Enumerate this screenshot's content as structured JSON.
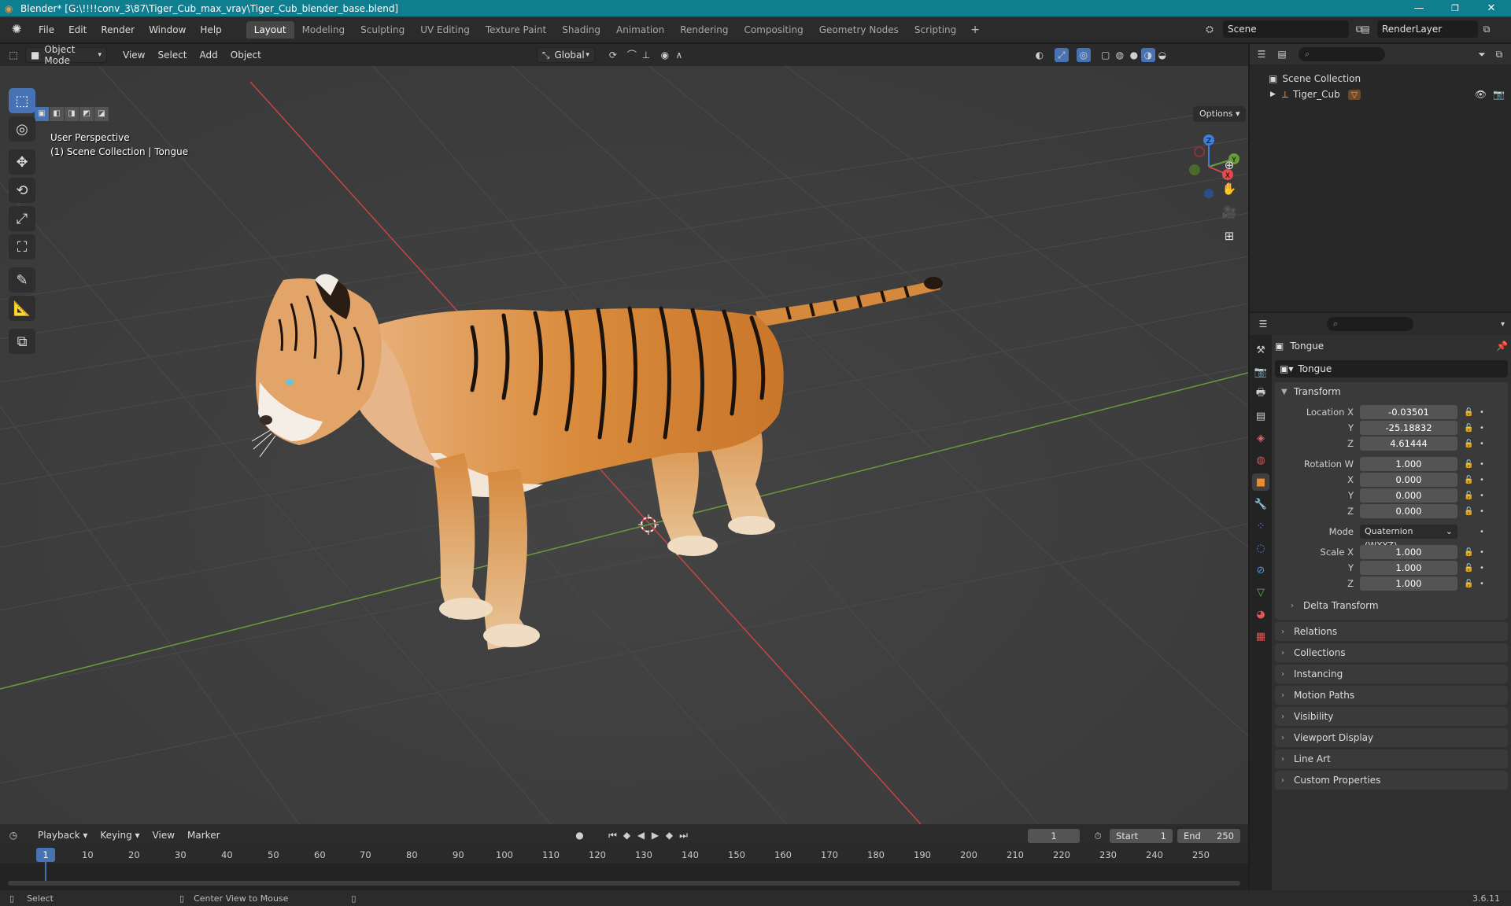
{
  "window": {
    "title": "Blender* [G:\\!!!!conv_3\\87\\Tiger_Cub_max_vray\\Tiger_Cub_blender_base.blend]",
    "minimize": "—",
    "maximize": "❐",
    "close": "✕"
  },
  "menus": [
    "File",
    "Edit",
    "Render",
    "Window",
    "Help"
  ],
  "workspaces": [
    "Layout",
    "Modeling",
    "Sculpting",
    "UV Editing",
    "Texture Paint",
    "Shading",
    "Animation",
    "Rendering",
    "Compositing",
    "Geometry Nodes",
    "Scripting"
  ],
  "active_workspace": "Layout",
  "add_workspace": "+",
  "scene_name": "Scene",
  "render_layer": "RenderLayer",
  "viewport": {
    "mode": "Object Mode",
    "menus": [
      "View",
      "Select",
      "Add",
      "Object"
    ],
    "orientation": "Global",
    "options_label": "Options",
    "info_line1": "User Perspective",
    "info_line2": "(1) Scene Collection | Tongue",
    "gizmo": {
      "z": "Z",
      "y": "Y",
      "x": "X"
    }
  },
  "outliner": {
    "search_placeholder": "",
    "root": "Scene Collection",
    "items": [
      {
        "name": "Tiger_Cub"
      }
    ]
  },
  "properties": {
    "object_name": "Tongue",
    "data_name": "Tongue",
    "transform_title": "Transform",
    "location": {
      "label": "Location X",
      "x": "-0.03501",
      "y": "-25.18832",
      "z": "4.61444"
    },
    "rotation": {
      "label": "Rotation W",
      "w": "1.000",
      "x": "0.000",
      "y": "0.000",
      "z": "0.000"
    },
    "mode_label": "Mode",
    "mode_value": "Quaternion (WXYZ)",
    "scale": {
      "label": "Scale X",
      "x": "1.000",
      "y": "1.000",
      "z": "1.000"
    },
    "axis_labels": {
      "y": "Y",
      "z": "Z",
      "x": "X"
    },
    "delta_transform": "Delta Transform",
    "panels": [
      "Relations",
      "Collections",
      "Instancing",
      "Motion Paths",
      "Visibility",
      "Viewport Display",
      "Line Art",
      "Custom Properties"
    ]
  },
  "timeline": {
    "menus": [
      "Playback",
      "Keying",
      "View",
      "Marker"
    ],
    "current_frame": "1",
    "start_label": "Start",
    "start_value": "1",
    "end_label": "End",
    "end_value": "250",
    "ruler": [
      "10",
      "20",
      "30",
      "40",
      "50",
      "60",
      "70",
      "80",
      "90",
      "100",
      "110",
      "120",
      "130",
      "140",
      "150",
      "160",
      "170",
      "180",
      "190",
      "200",
      "210",
      "220",
      "230",
      "240",
      "250"
    ],
    "playhead_label": "1"
  },
  "status": {
    "select": "Select",
    "center": "Center View to Mouse",
    "version": "3.6.11"
  },
  "colors": {
    "titlebar": "#0f7f8f",
    "accent": "#4772b3",
    "x_axis": "#c64545",
    "y_axis": "#6a9c38"
  }
}
